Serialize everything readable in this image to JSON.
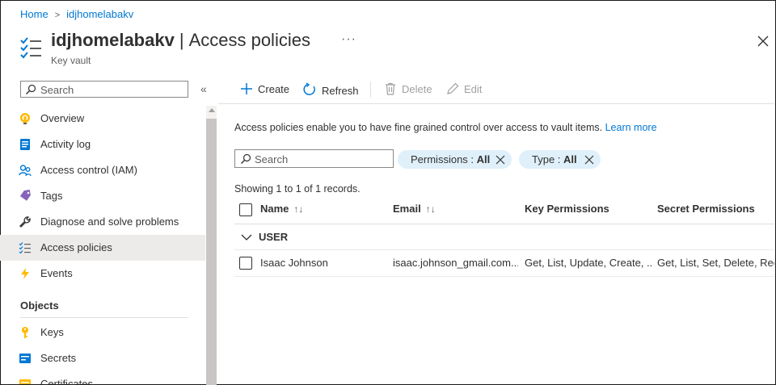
{
  "breadcrumb": {
    "home": "Home",
    "current": "idjhomelabakv",
    "separator": ">"
  },
  "header": {
    "resource_name": "idjhomelabakv",
    "separator": "|",
    "page_title": "Access policies",
    "subtitle": "Key vault",
    "more": "···",
    "close_icon": "close-icon"
  },
  "sidebar": {
    "search_placeholder": "Search",
    "collapse": "«",
    "items": [
      {
        "label": "Overview",
        "icon": "lightbulb-icon"
      },
      {
        "label": "Activity log",
        "icon": "activity-log-icon"
      },
      {
        "label": "Access control (IAM)",
        "icon": "people-icon"
      },
      {
        "label": "Tags",
        "icon": "tag-icon"
      },
      {
        "label": "Diagnose and solve problems",
        "icon": "wrench-icon"
      },
      {
        "label": "Access policies",
        "icon": "list-icon",
        "active": true
      },
      {
        "label": "Events",
        "icon": "lightning-icon"
      }
    ],
    "section_objects": "Objects",
    "object_items": [
      {
        "label": "Keys",
        "icon": "key-icon"
      },
      {
        "label": "Secrets",
        "icon": "secrets-icon"
      },
      {
        "label": "Certificates",
        "icon": "certificate-icon"
      }
    ]
  },
  "toolbar": {
    "create": "Create",
    "refresh": "Refresh",
    "delete": "Delete",
    "edit": "Edit"
  },
  "description": {
    "text": "Access policies enable you to have fine grained control over access to vault items.",
    "link": "Learn more"
  },
  "filters": {
    "search_placeholder": "Search",
    "permissions_key": "Permissions :",
    "permissions_value": "All",
    "type_key": "Type :",
    "type_value": "All"
  },
  "records_text": "Showing 1 to 1 of 1 records.",
  "table": {
    "columns": [
      "Name",
      "Email",
      "Key Permissions",
      "Secret Permissions"
    ],
    "sort_glyph": "↑↓",
    "group_label": "USER",
    "rows": [
      {
        "name": "Isaac Johnson",
        "email": "isaac.johnson_gmail.com...",
        "key_permissions": "Get, List, Update, Create, ...",
        "secret_permissions": "Get, List, Set, Delete, Rec..."
      }
    ]
  },
  "colors": {
    "accent": "#0078d4",
    "pill_bg": "#dff0fa",
    "active_nav_bg": "#edebe9"
  }
}
